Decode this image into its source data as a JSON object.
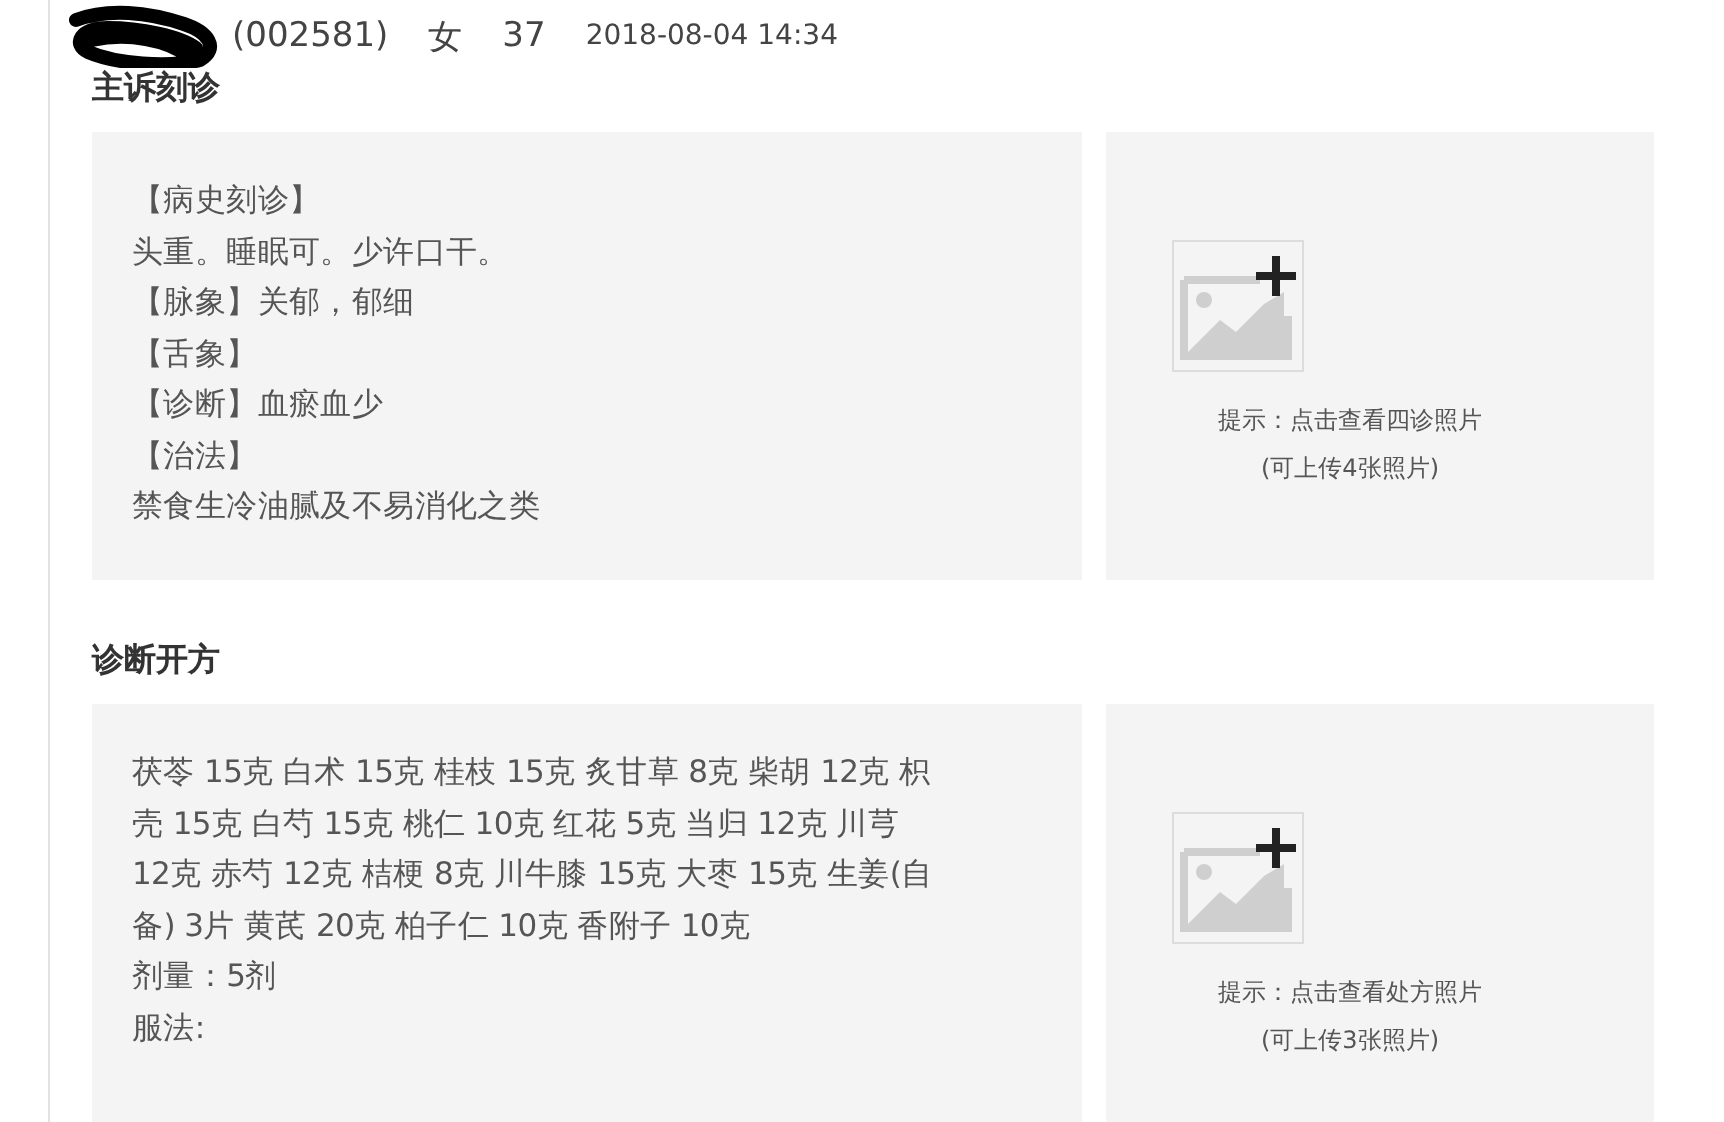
{
  "patient": {
    "id": "(002581)",
    "sex": "女",
    "age": "37",
    "datetime": "2018-08-04 14:34"
  },
  "sections": [
    {
      "title": "主诉刻诊",
      "lines": [
        "【病史刻诊】",
        "头重。睡眠可。少许口干。",
        "【脉象】关郁，郁细",
        "【舌象】",
        "【诊断】血瘀血少",
        "【治法】",
        "禁食生冷油腻及不易消化之类"
      ],
      "photo": {
        "hint": "提示：点击查看四诊照片",
        "limit": "(可上传4张照片)"
      }
    },
    {
      "title": "诊断开方",
      "lines": [
        "茯苓 15克 白术 15克 桂枝 15克 炙甘草 8克 柴胡 12克 枳",
        "壳 15克 白芍 15克 桃仁 10克 红花 5克 当归 12克 川芎",
        "12克 赤芍 12克 桔梗 8克 川牛膝 15克 大枣 15克 生姜(自",
        "备) 3片 黄芪 20克 柏子仁 10克 香附子 10克",
        "剂量：5剂",
        "服法:"
      ],
      "photo": {
        "hint": "提示：点击查看处方照片",
        "limit": "(可上传3张照片)"
      }
    }
  ]
}
